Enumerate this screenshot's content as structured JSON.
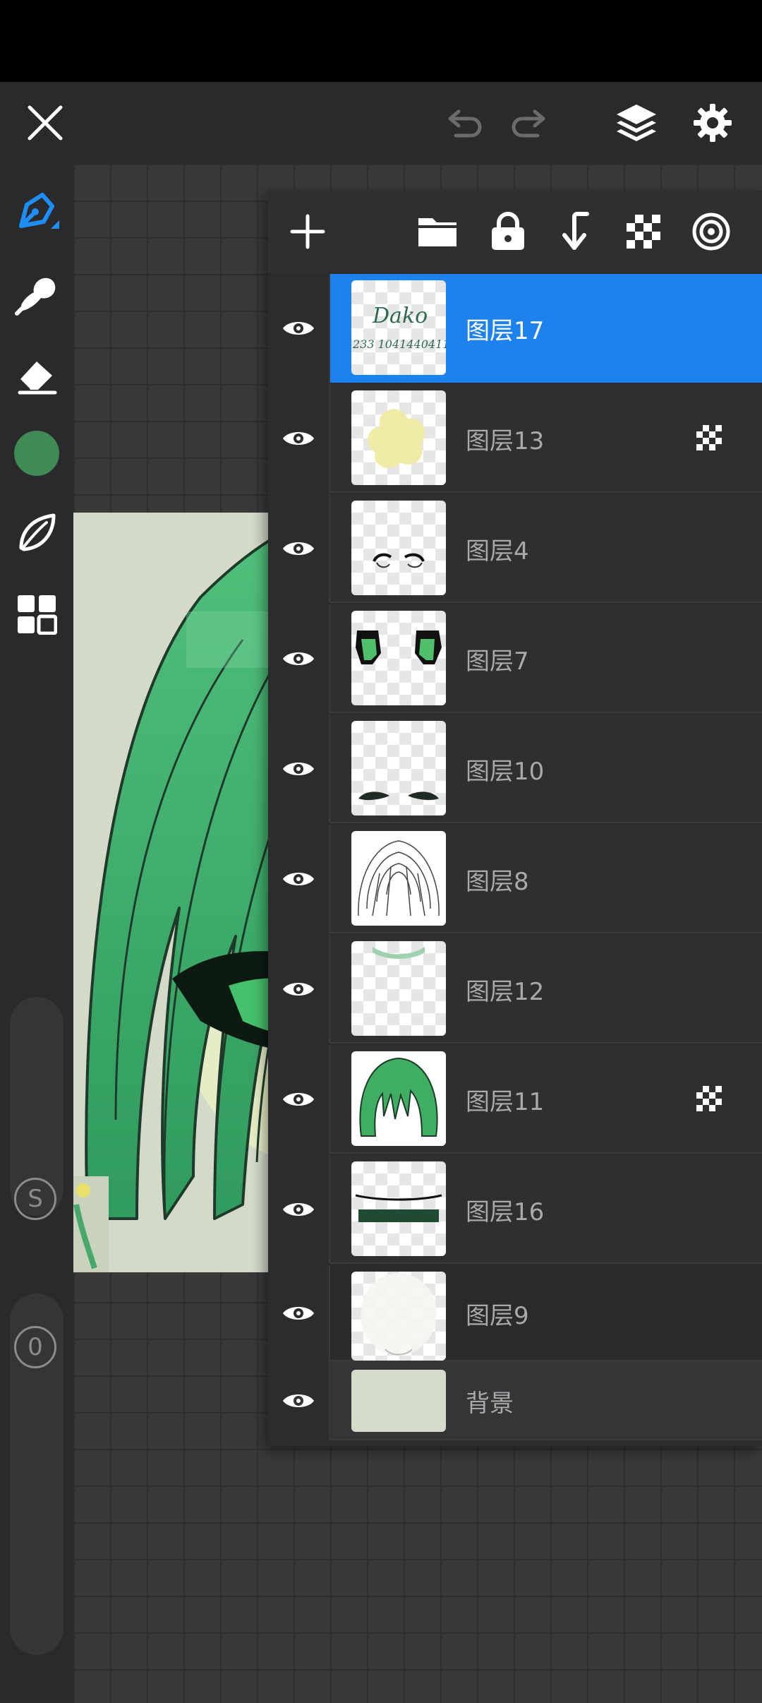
{
  "toolbar": {
    "close": "close-icon",
    "undo": "undo-icon",
    "redo": "redo-icon",
    "layers": "layers-icon",
    "settings": "gear-icon"
  },
  "tools": [
    "pen-tool-icon",
    "smudge-icon",
    "eraser-icon",
    "color-swatch",
    "leaf-icon",
    "grid-menu-icon"
  ],
  "current_color": "#3f8a55",
  "size_slider": {
    "label": "S"
  },
  "opacity_slider": {
    "label": "0"
  },
  "layers_panel": {
    "actions": [
      "add-layer-icon",
      "folder-icon",
      "lock-icon",
      "merge-down-icon",
      "alpha-lock-icon",
      "blend-mode-icon"
    ],
    "layers": [
      {
        "name": "图层17",
        "selected": true,
        "visible": true,
        "clipped": false,
        "thumb_text": "Dako",
        "thumb_subtext": "233 1041440411"
      },
      {
        "name": "图层13",
        "selected": false,
        "visible": true,
        "clipped": true
      },
      {
        "name": "图层4",
        "selected": false,
        "visible": true,
        "clipped": false
      },
      {
        "name": "图层7",
        "selected": false,
        "visible": true,
        "clipped": false
      },
      {
        "name": "图层10",
        "selected": false,
        "visible": true,
        "clipped": false
      },
      {
        "name": "图层8",
        "selected": false,
        "visible": true,
        "clipped": false
      },
      {
        "name": "图层12",
        "selected": false,
        "visible": true,
        "clipped": false
      },
      {
        "name": "图层11",
        "selected": false,
        "visible": true,
        "clipped": true
      },
      {
        "name": "图层16",
        "selected": false,
        "visible": true,
        "clipped": false
      },
      {
        "name": "图层9",
        "selected": false,
        "visible": true,
        "clipped": false
      }
    ],
    "background_layer": {
      "name": "背景",
      "visible": true,
      "color": "#d6dccb"
    }
  }
}
